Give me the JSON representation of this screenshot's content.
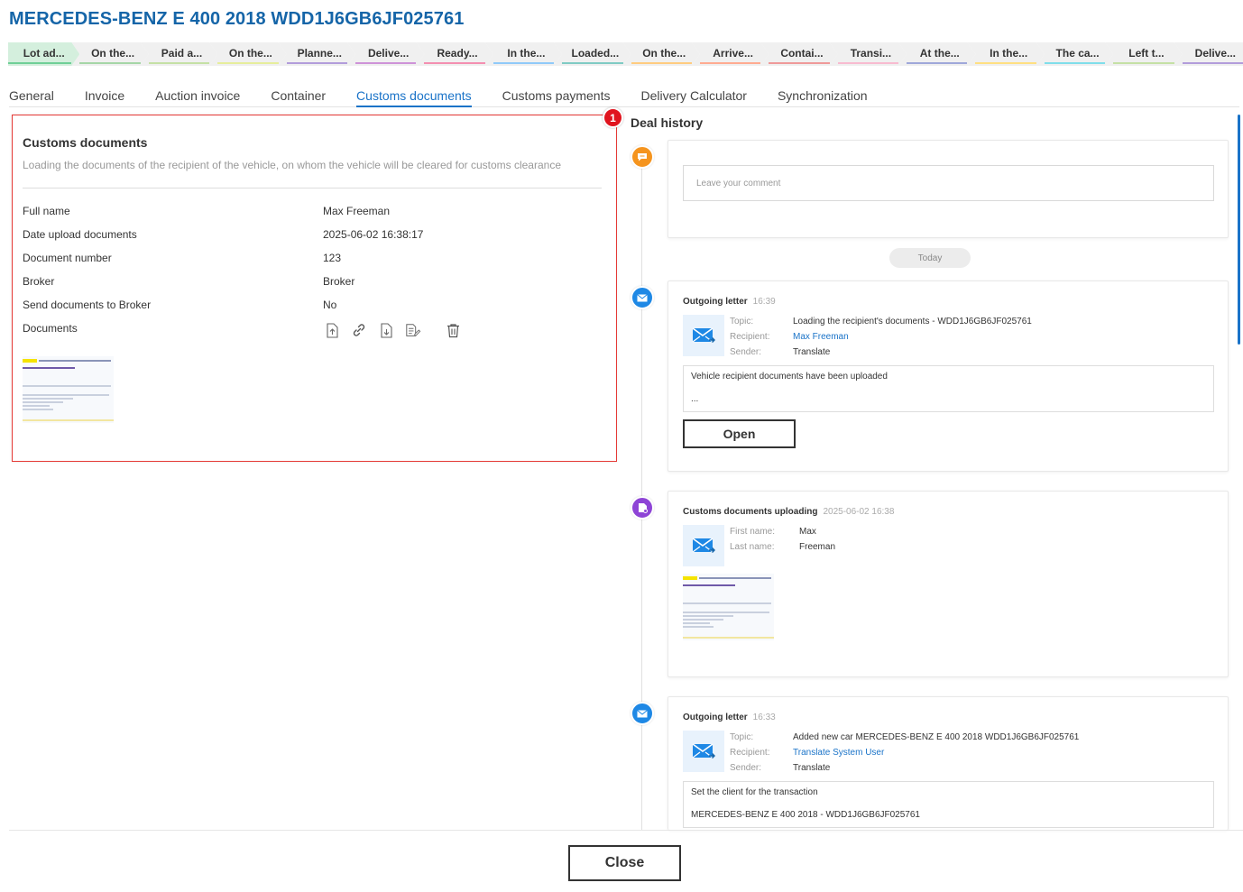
{
  "title": "MERCEDES-BENZ E 400 2018 WDD1J6GB6JF025761",
  "stages": [
    {
      "label": "Lot ad...",
      "done": true,
      "color": "#6fcf97"
    },
    {
      "label": "On the...",
      "done": false,
      "color": "#a5d6a7"
    },
    {
      "label": "Paid a...",
      "done": false,
      "color": "#c5e1a5"
    },
    {
      "label": "On the...",
      "done": false,
      "color": "#e6ee9c"
    },
    {
      "label": "Planne...",
      "done": false,
      "color": "#b39ddb"
    },
    {
      "label": "Delive...",
      "done": false,
      "color": "#ce93d8"
    },
    {
      "label": "Ready...",
      "done": false,
      "color": "#f48fb1"
    },
    {
      "label": "In the...",
      "done": false,
      "color": "#90caf9"
    },
    {
      "label": "Loaded...",
      "done": false,
      "color": "#80cbc4"
    },
    {
      "label": "On the...",
      "done": false,
      "color": "#ffcc80"
    },
    {
      "label": "Arrive...",
      "done": false,
      "color": "#ffab91"
    },
    {
      "label": "Contai...",
      "done": false,
      "color": "#ef9a9a"
    },
    {
      "label": "Transi...",
      "done": false,
      "color": "#f8bbd0"
    },
    {
      "label": "At the...",
      "done": false,
      "color": "#9fa8da"
    },
    {
      "label": "In the...",
      "done": false,
      "color": "#ffe082"
    },
    {
      "label": "The ca...",
      "done": false,
      "color": "#80deea"
    },
    {
      "label": "Left t...",
      "done": false,
      "color": "#c5e1a5"
    },
    {
      "label": "Delive...",
      "done": false,
      "color": "#b39ddb"
    }
  ],
  "tabs": [
    {
      "label": "General",
      "active": false
    },
    {
      "label": "Invoice",
      "active": false
    },
    {
      "label": "Auction invoice",
      "active": false
    },
    {
      "label": "Container",
      "active": false
    },
    {
      "label": "Customs documents",
      "active": true
    },
    {
      "label": "Customs payments",
      "active": false
    },
    {
      "label": "Delivery Calculator",
      "active": false
    },
    {
      "label": "Synchronization",
      "active": false
    }
  ],
  "customs": {
    "badge": "1",
    "title": "Customs documents",
    "subtitle": "Loading the documents of the recipient of the vehicle, on whom the vehicle will be cleared for customs clearance",
    "fields": [
      {
        "label": "Full name",
        "value": "Max Freeman"
      },
      {
        "label": "Date upload documents",
        "value": "2025-06-02 16:38:17"
      },
      {
        "label": "Document number",
        "value": "123"
      },
      {
        "label": "Broker",
        "value": "Broker"
      },
      {
        "label": "Send documents to Broker",
        "value": "No"
      },
      {
        "label": "Documents",
        "value": ""
      }
    ],
    "actions": [
      "upload-icon",
      "link-icon",
      "download-icon",
      "edit-doc-icon",
      "trash-icon"
    ]
  },
  "history": {
    "title": "Deal history",
    "comment_placeholder": "Leave your comment",
    "today": "Today",
    "events": [
      {
        "title": "Outgoing letter",
        "time": "16:39",
        "topic_label": "Topic:",
        "topic": "Loading the recipient's documents - WDD1J6GB6JF025761",
        "recipient_label": "Recipient:",
        "recipient": "Max Freeman",
        "sender_label": "Sender:",
        "sender": "Translate",
        "message_line1": "Vehicle recipient documents have been uploaded",
        "message_line2": "...",
        "open_label": "Open"
      },
      {
        "title": "Customs documents uploading",
        "time": "2025-06-02 16:38",
        "first_name_label": "First name:",
        "first_name": "Max",
        "last_name_label": "Last name:",
        "last_name": "Freeman"
      },
      {
        "title": "Outgoing letter",
        "time": "16:33",
        "topic_label": "Topic:",
        "topic": "Added new car MERCEDES-BENZ E 400 2018 WDD1J6GB6JF025761",
        "recipient_label": "Recipient:",
        "recipient": "Translate System User",
        "sender_label": "Sender:",
        "sender": "Translate",
        "message_line1": "Set the client for the transaction",
        "message_line2": "MERCEDES-BENZ E 400 2018 - WDD1J6GB6JF025761"
      }
    ]
  },
  "close_label": "Close",
  "colors": {
    "accent": "#1a73c8",
    "title": "#1565a8",
    "highlight_border": "#e53935",
    "badge": "#e0141e",
    "comment_dot": "#f5941e",
    "letter_dot": "#1e88e5",
    "upload_dot": "#8e44d6"
  }
}
